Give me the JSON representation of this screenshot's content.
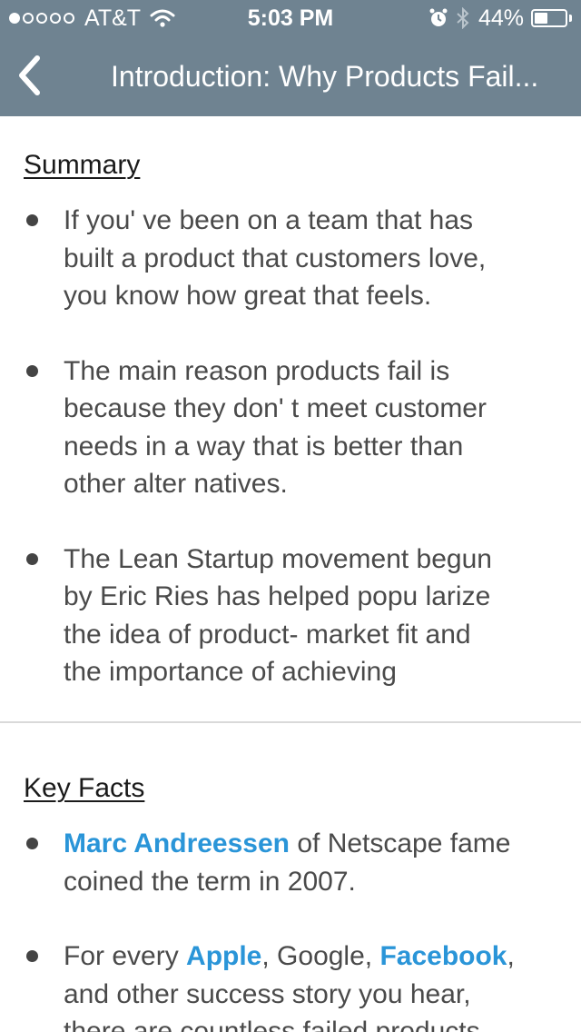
{
  "status_bar": {
    "carrier": "AT&T",
    "time": "5:03 PM",
    "battery_percent": "44%",
    "battery_level": 0.44,
    "signal_bars_filled": 1,
    "signal_bars_total": 5,
    "icons": [
      "wifi-icon",
      "alarm-icon",
      "bluetooth-icon",
      "battery-icon"
    ]
  },
  "nav": {
    "back_icon": "chevron-left-icon",
    "title": "Introduction: Why Products Fail..."
  },
  "colors": {
    "header_bg": "#6f8391",
    "link": "#2a95d8",
    "body_text": "#4a4a4a"
  },
  "summary": {
    "title": "Summary",
    "bullets": [
      [
        "If you' ve been on a team that has",
        "built a product that customers love,",
        "you know how great that feels."
      ],
      [
        "The main reason products fail is",
        "because they don' t meet customer",
        "needs in a way that is better than",
        "other alter natives."
      ],
      [
        "The Lean Startup movement begun",
        "by Eric Ries has helped popu larize",
        "the idea of product- market fit and",
        "the importance of achieving"
      ]
    ]
  },
  "key_facts": {
    "title": "Key Facts",
    "fact1": {
      "link": "Marc Andreessen",
      "line1_rest": " of Netscape fame",
      "line2": "coined the term in 2007."
    },
    "fact2": {
      "prefix": "For every ",
      "link_apple": "Apple",
      "mid": ", Google, ",
      "link_facebook": "Facebook",
      "comma": ",",
      "line2": "and other success story you hear,",
      "line3": "there are countless failed products"
    }
  }
}
